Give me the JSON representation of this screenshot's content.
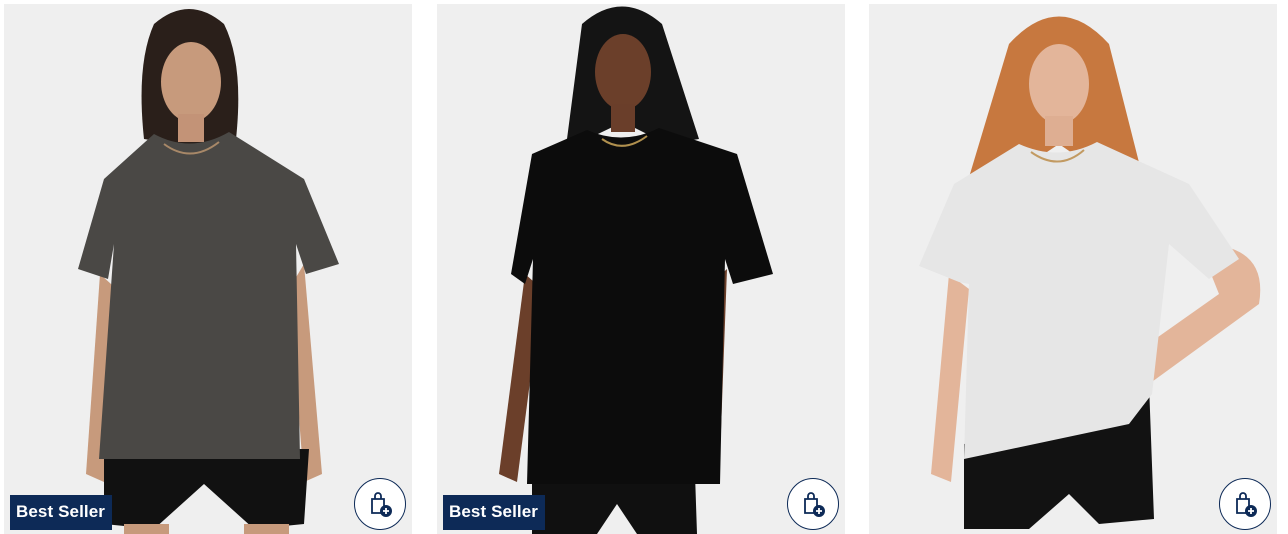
{
  "products": [
    {
      "badge": "Best Seller",
      "shirt_color": "#4a4845",
      "icon": "add-to-bag-icon"
    },
    {
      "badge": "Best Seller",
      "shirt_color": "#0c0c0c",
      "icon": "add-to-bag-icon"
    },
    {
      "badge": "",
      "shirt_color": "#e6e6e6",
      "icon": "add-to-bag-icon"
    }
  ],
  "colors": {
    "badge_bg": "#0d2a57",
    "card_bg": "#efefef"
  }
}
